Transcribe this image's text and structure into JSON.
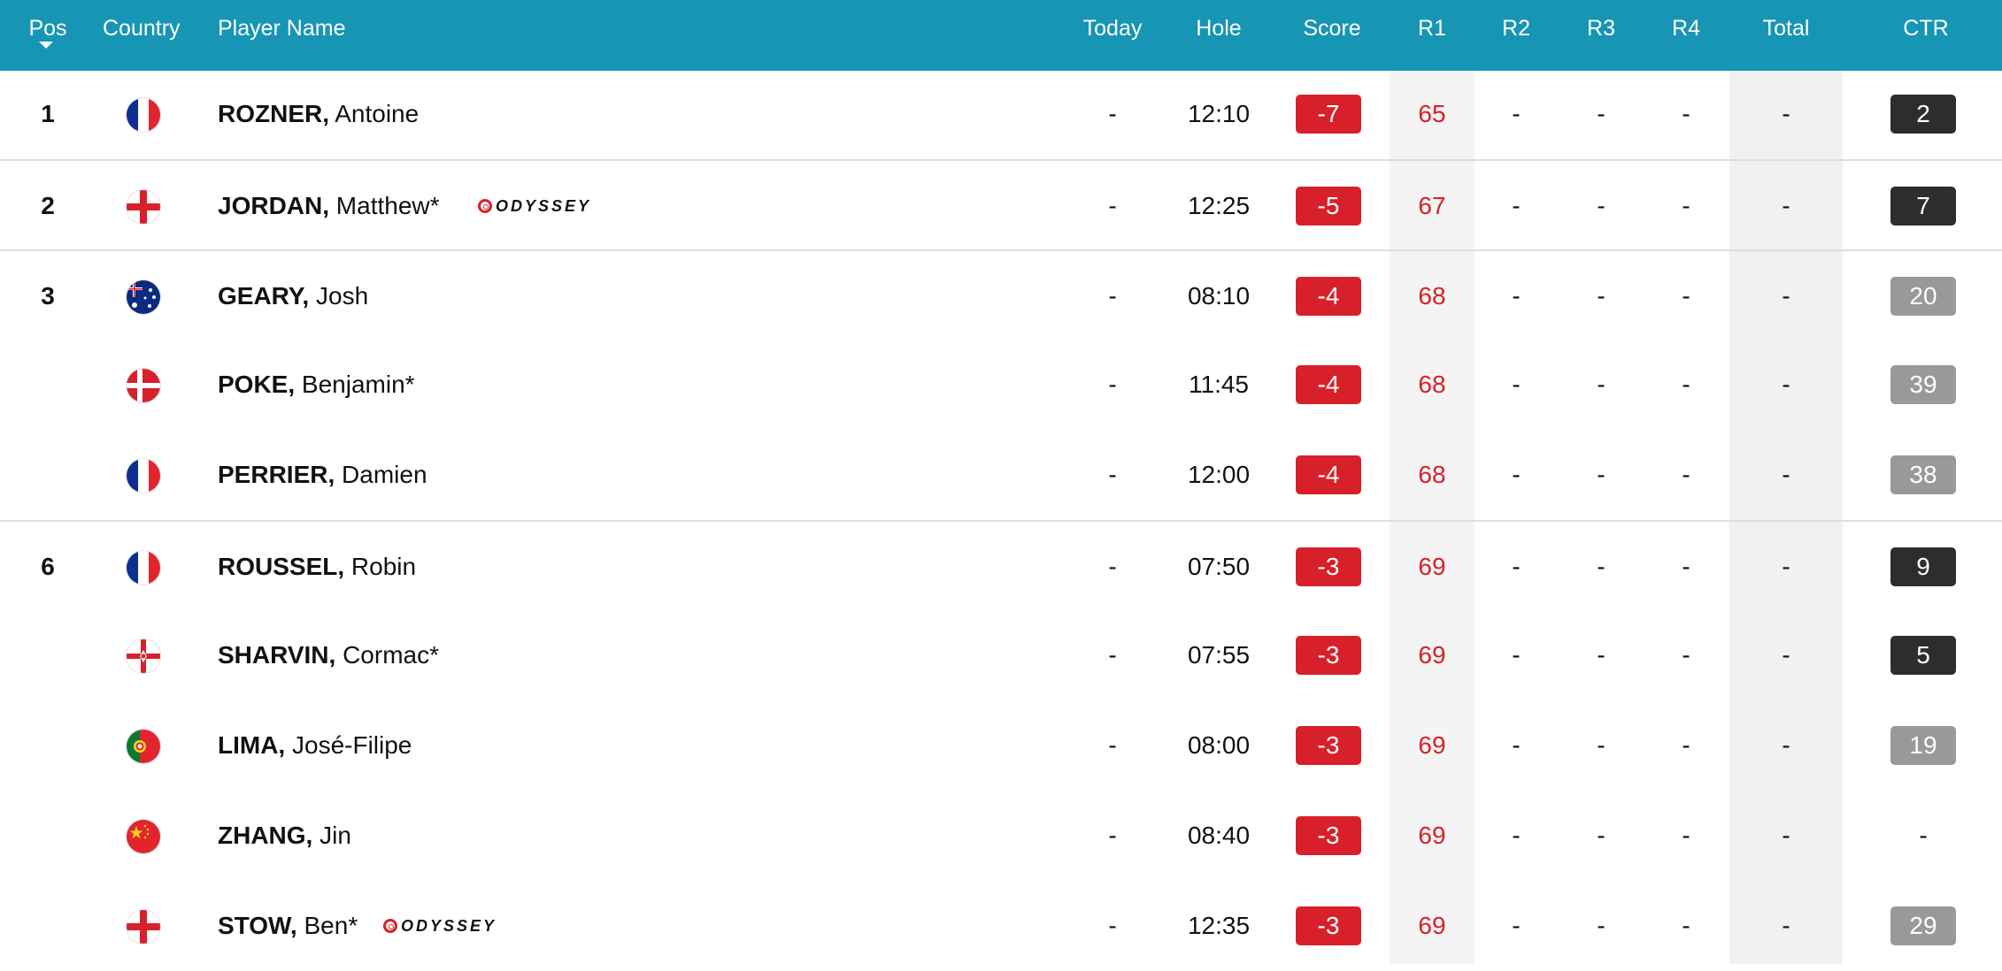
{
  "header": {
    "pos": "Pos",
    "country": "Country",
    "player_name": "Player Name",
    "today": "Today",
    "hole": "Hole",
    "score": "Score",
    "r1": "R1",
    "r2": "R2",
    "r3": "R3",
    "r4": "R4",
    "total": "Total",
    "ctr": "CTR"
  },
  "sponsor_text": "ODYSSEY",
  "colors": {
    "header_bg": "#1795b4",
    "score_badge": "#d8202a",
    "ctr_dark": "#2d2d2d",
    "ctr_grey": "#999999"
  },
  "rows": [
    {
      "pos": "1",
      "country": "France",
      "flag_icon": "france-flag-icon",
      "last": "ROZNER,",
      "first": "Antoine",
      "sponsor": false,
      "today": "-",
      "hole": "12:10",
      "score": "-7",
      "r1": "65",
      "r2": "-",
      "r3": "-",
      "r4": "-",
      "total": "-",
      "ctr": "2",
      "ctr_style": "dark"
    },
    {
      "pos": "2",
      "country": "England",
      "flag_icon": "england-flag-icon",
      "last": "JORDAN,",
      "first": "Matthew*",
      "sponsor": true,
      "today": "-",
      "hole": "12:25",
      "score": "-5",
      "r1": "67",
      "r2": "-",
      "r3": "-",
      "r4": "-",
      "total": "-",
      "ctr": "7",
      "ctr_style": "dark"
    },
    {
      "pos": "3",
      "country": "Australia",
      "flag_icon": "australia-flag-icon",
      "last": "GEARY,",
      "first": "Josh",
      "sponsor": false,
      "today": "-",
      "hole": "08:10",
      "score": "-4",
      "r1": "68",
      "r2": "-",
      "r3": "-",
      "r4": "-",
      "total": "-",
      "ctr": "20",
      "ctr_style": "grey"
    },
    {
      "pos": "",
      "country": "Denmark",
      "flag_icon": "denmark-flag-icon",
      "last": "POKE,",
      "first": "Benjamin*",
      "sponsor": false,
      "today": "-",
      "hole": "11:45",
      "score": "-4",
      "r1": "68",
      "r2": "-",
      "r3": "-",
      "r4": "-",
      "total": "-",
      "ctr": "39",
      "ctr_style": "grey"
    },
    {
      "pos": "",
      "country": "France",
      "flag_icon": "france-flag-icon",
      "last": "PERRIER,",
      "first": "Damien",
      "sponsor": false,
      "today": "-",
      "hole": "12:00",
      "score": "-4",
      "r1": "68",
      "r2": "-",
      "r3": "-",
      "r4": "-",
      "total": "-",
      "ctr": "38",
      "ctr_style": "grey"
    },
    {
      "pos": "6",
      "country": "France",
      "flag_icon": "france-flag-icon",
      "last": "ROUSSEL,",
      "first": "Robin",
      "sponsor": false,
      "today": "-",
      "hole": "07:50",
      "score": "-3",
      "r1": "69",
      "r2": "-",
      "r3": "-",
      "r4": "-",
      "total": "-",
      "ctr": "9",
      "ctr_style": "dark"
    },
    {
      "pos": "",
      "country": "Northern Ireland",
      "flag_icon": "northern-ireland-flag-icon",
      "last": "SHARVIN,",
      "first": "Cormac*",
      "sponsor": false,
      "today": "-",
      "hole": "07:55",
      "score": "-3",
      "r1": "69",
      "r2": "-",
      "r3": "-",
      "r4": "-",
      "total": "-",
      "ctr": "5",
      "ctr_style": "dark"
    },
    {
      "pos": "",
      "country": "Portugal",
      "flag_icon": "portugal-flag-icon",
      "last": "LIMA,",
      "first": "José-Filipe",
      "sponsor": false,
      "today": "-",
      "hole": "08:00",
      "score": "-3",
      "r1": "69",
      "r2": "-",
      "r3": "-",
      "r4": "-",
      "total": "-",
      "ctr": "19",
      "ctr_style": "grey"
    },
    {
      "pos": "",
      "country": "China",
      "flag_icon": "china-flag-icon",
      "last": "ZHANG,",
      "first": "Jin",
      "sponsor": false,
      "today": "-",
      "hole": "08:40",
      "score": "-3",
      "r1": "69",
      "r2": "-",
      "r3": "-",
      "r4": "-",
      "total": "-",
      "ctr": "-",
      "ctr_style": "none"
    },
    {
      "pos": "",
      "country": "England",
      "flag_icon": "england-flag-icon",
      "last": "STOW,",
      "first": "Ben*",
      "sponsor": true,
      "today": "-",
      "hole": "12:35",
      "score": "-3",
      "r1": "69",
      "r2": "-",
      "r3": "-",
      "r4": "-",
      "total": "-",
      "ctr": "29",
      "ctr_style": "grey"
    }
  ]
}
